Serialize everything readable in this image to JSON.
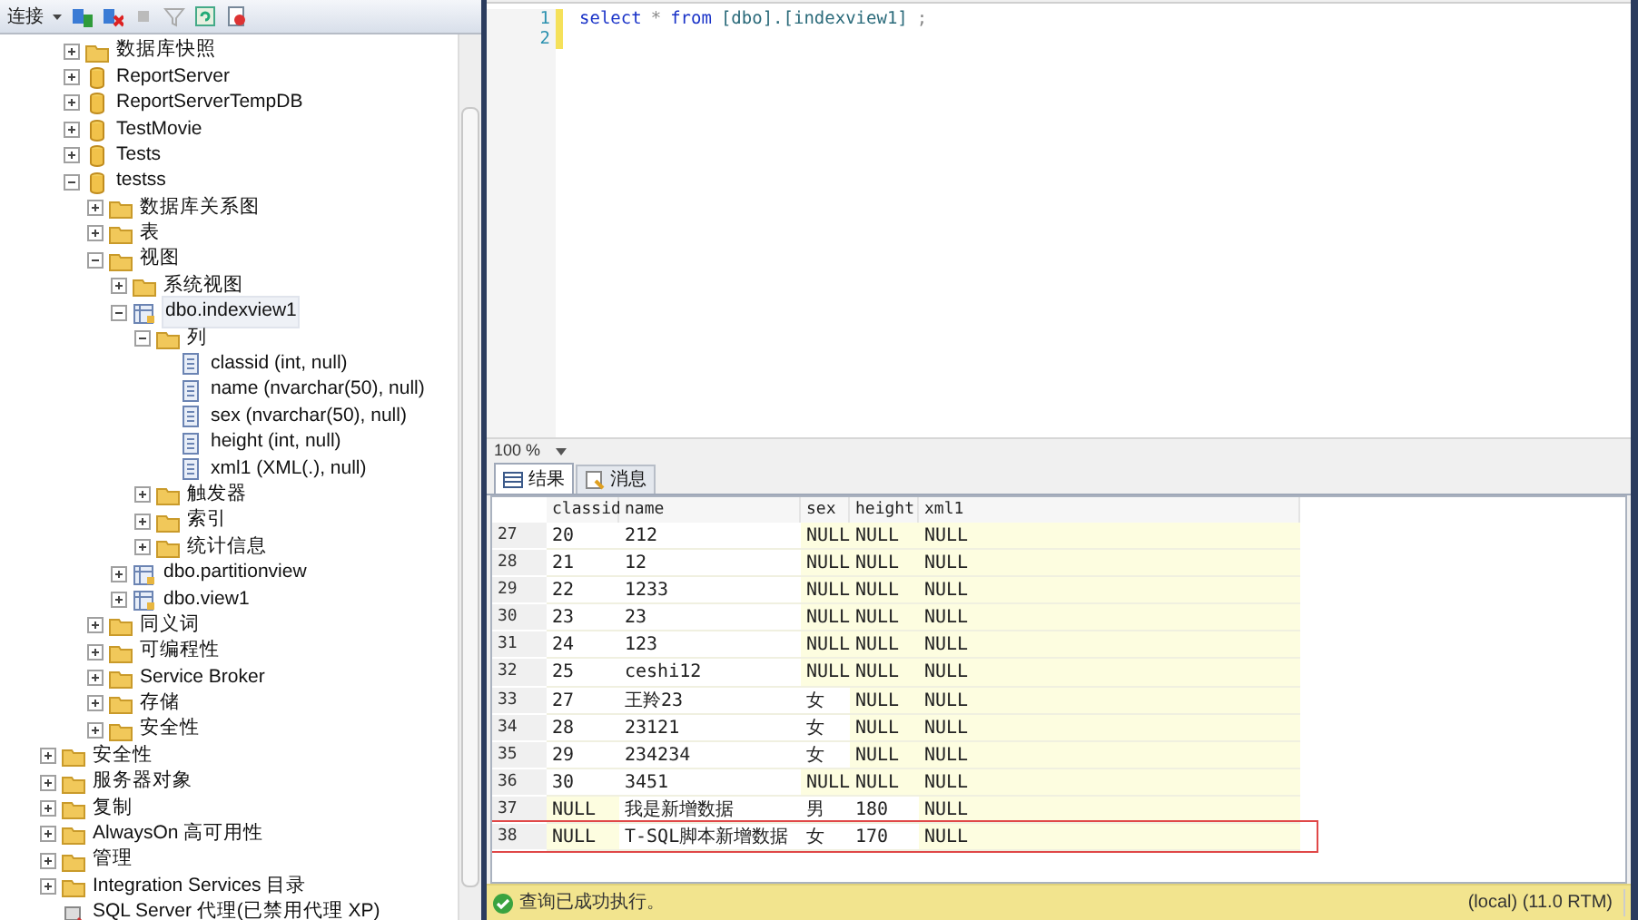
{
  "toolbar": {
    "connect_label": "连接"
  },
  "tree": {
    "continued_children": [
      {
        "label": "数据库快照",
        "kind": "folder",
        "expanded": false
      },
      {
        "label": "ReportServer",
        "kind": "database",
        "expanded": false
      },
      {
        "label": "ReportServerTempDB",
        "kind": "database",
        "expanded": false
      },
      {
        "label": "TestMovie",
        "kind": "database",
        "expanded": false
      },
      {
        "label": "Tests",
        "kind": "database",
        "expanded": false
      },
      {
        "label": "testss",
        "kind": "database",
        "expanded": true,
        "children": [
          {
            "label": "数据库关系图",
            "kind": "folder",
            "expanded": false
          },
          {
            "label": "表",
            "kind": "folder",
            "expanded": false
          },
          {
            "label": "视图",
            "kind": "folder",
            "expanded": true,
            "children": [
              {
                "label": "系统视图",
                "kind": "folder",
                "expanded": false
              },
              {
                "label": "dbo.indexview1",
                "kind": "view",
                "expanded": true,
                "selected": true,
                "children": [
                  {
                    "label": "列",
                    "kind": "folder",
                    "expanded": true,
                    "children": [
                      {
                        "label": "classid (int, null)",
                        "kind": "column"
                      },
                      {
                        "label": "name (nvarchar(50), null)",
                        "kind": "column"
                      },
                      {
                        "label": "sex (nvarchar(50), null)",
                        "kind": "column"
                      },
                      {
                        "label": "height (int, null)",
                        "kind": "column"
                      },
                      {
                        "label": "xml1 (XML(.), null)",
                        "kind": "column"
                      }
                    ]
                  },
                  {
                    "label": "触发器",
                    "kind": "folder",
                    "expanded": false
                  },
                  {
                    "label": "索引",
                    "kind": "folder",
                    "expanded": false
                  },
                  {
                    "label": "统计信息",
                    "kind": "folder",
                    "expanded": false
                  }
                ]
              },
              {
                "label": "dbo.partitionview",
                "kind": "view",
                "expanded": false,
                "selected": false
              },
              {
                "label": "dbo.view1",
                "kind": "view",
                "expanded": false,
                "selected": false
              }
            ]
          },
          {
            "label": "同义词",
            "kind": "folder",
            "expanded": false
          },
          {
            "label": "可编程性",
            "kind": "folder",
            "expanded": false
          },
          {
            "label": "Service Broker",
            "kind": "folder",
            "expanded": false
          },
          {
            "label": "存储",
            "kind": "folder",
            "expanded": false
          },
          {
            "label": "安全性",
            "kind": "folder",
            "expanded": false
          }
        ]
      }
    ],
    "items": [
      {
        "label": "安全性",
        "kind": "folder",
        "expanded": false
      },
      {
        "label": "服务器对象",
        "kind": "folder",
        "expanded": false
      },
      {
        "label": "复制",
        "kind": "folder",
        "expanded": false
      },
      {
        "label": "AlwaysOn 高可用性",
        "kind": "folder",
        "expanded": false
      },
      {
        "label": "管理",
        "kind": "folder",
        "expanded": false
      },
      {
        "label": "Integration Services 目录",
        "kind": "folder",
        "expanded": false
      },
      {
        "label": "SQL Server 代理(已禁用代理 XP)",
        "kind": "agent"
      }
    ]
  },
  "editor": {
    "lines": [
      {
        "number": "1",
        "tokens": [
          {
            "kind": "keyword",
            "text": "select"
          },
          {
            "kind": "operator",
            "text": "*"
          },
          {
            "kind": "keyword",
            "text": "from"
          },
          {
            "kind": "identifier",
            "text": "[dbo].[indexview1]"
          },
          {
            "kind": "operator",
            "text": ";"
          }
        ]
      },
      {
        "number": "2"
      }
    ]
  },
  "zoom": "100 %",
  "result_tabs": [
    {
      "label": "结果",
      "kind": "grid",
      "selected": true
    },
    {
      "label": "消息",
      "kind": "message",
      "selected": false
    }
  ],
  "grid": {
    "columns": [
      "classid",
      "name",
      "sex",
      "height",
      "xml1"
    ],
    "rows": [
      {
        "number": "27",
        "outlined": false,
        "cells": [
          {
            "text": "20",
            "null": false
          },
          {
            "text": "212",
            "null": false
          },
          {
            "text": "NULL",
            "null": true
          },
          {
            "text": "NULL",
            "null": true
          },
          {
            "text": "NULL",
            "null": true
          }
        ]
      },
      {
        "number": "28",
        "outlined": false,
        "cells": [
          {
            "text": "21",
            "null": false
          },
          {
            "text": "12",
            "null": false
          },
          {
            "text": "NULL",
            "null": true
          },
          {
            "text": "NULL",
            "null": true
          },
          {
            "text": "NULL",
            "null": true
          }
        ]
      },
      {
        "number": "29",
        "outlined": false,
        "cells": [
          {
            "text": "22",
            "null": false
          },
          {
            "text": "1233",
            "null": false
          },
          {
            "text": "NULL",
            "null": true
          },
          {
            "text": "NULL",
            "null": true
          },
          {
            "text": "NULL",
            "null": true
          }
        ]
      },
      {
        "number": "30",
        "outlined": false,
        "cells": [
          {
            "text": "23",
            "null": false
          },
          {
            "text": "23",
            "null": false
          },
          {
            "text": "NULL",
            "null": true
          },
          {
            "text": "NULL",
            "null": true
          },
          {
            "text": "NULL",
            "null": true
          }
        ]
      },
      {
        "number": "31",
        "outlined": false,
        "cells": [
          {
            "text": "24",
            "null": false
          },
          {
            "text": "123",
            "null": false
          },
          {
            "text": "NULL",
            "null": true
          },
          {
            "text": "NULL",
            "null": true
          },
          {
            "text": "NULL",
            "null": true
          }
        ]
      },
      {
        "number": "32",
        "outlined": false,
        "cells": [
          {
            "text": "25",
            "null": false
          },
          {
            "text": "ceshi12",
            "null": false
          },
          {
            "text": "NULL",
            "null": true
          },
          {
            "text": "NULL",
            "null": true
          },
          {
            "text": "NULL",
            "null": true
          }
        ]
      },
      {
        "number": "33",
        "outlined": false,
        "cells": [
          {
            "text": "27",
            "null": false
          },
          {
            "text": "王羚23",
            "null": false
          },
          {
            "text": "女",
            "null": false
          },
          {
            "text": "NULL",
            "null": true
          },
          {
            "text": "NULL",
            "null": true
          }
        ]
      },
      {
        "number": "34",
        "outlined": false,
        "cells": [
          {
            "text": "28",
            "null": false
          },
          {
            "text": "23121",
            "null": false
          },
          {
            "text": "女",
            "null": false
          },
          {
            "text": "NULL",
            "null": true
          },
          {
            "text": "NULL",
            "null": true
          }
        ]
      },
      {
        "number": "35",
        "outlined": false,
        "cells": [
          {
            "text": "29",
            "null": false
          },
          {
            "text": "234234",
            "null": false
          },
          {
            "text": "女",
            "null": false
          },
          {
            "text": "NULL",
            "null": true
          },
          {
            "text": "NULL",
            "null": true
          }
        ]
      },
      {
        "number": "36",
        "outlined": false,
        "cells": [
          {
            "text": "30",
            "null": false
          },
          {
            "text": "3451",
            "null": false
          },
          {
            "text": "NULL",
            "null": true
          },
          {
            "text": "NULL",
            "null": true
          },
          {
            "text": "NULL",
            "null": true
          }
        ]
      },
      {
        "number": "37",
        "outlined": false,
        "cells": [
          {
            "text": "NULL",
            "null": true
          },
          {
            "text": "我是新增数据",
            "null": false
          },
          {
            "text": "男",
            "null": false
          },
          {
            "text": "180",
            "null": false
          },
          {
            "text": "NULL",
            "null": true
          }
        ]
      },
      {
        "number": "38",
        "outlined": true,
        "cells": [
          {
            "text": "NULL",
            "null": true
          },
          {
            "text": "T-SQL脚本新增数据",
            "null": false
          },
          {
            "text": "女",
            "null": false
          },
          {
            "text": "170",
            "null": false
          },
          {
            "text": "NULL",
            "null": true
          }
        ]
      }
    ]
  },
  "status_bar": {
    "message": "查询已成功执行。",
    "server": "(local) (11.0 RTM)"
  }
}
